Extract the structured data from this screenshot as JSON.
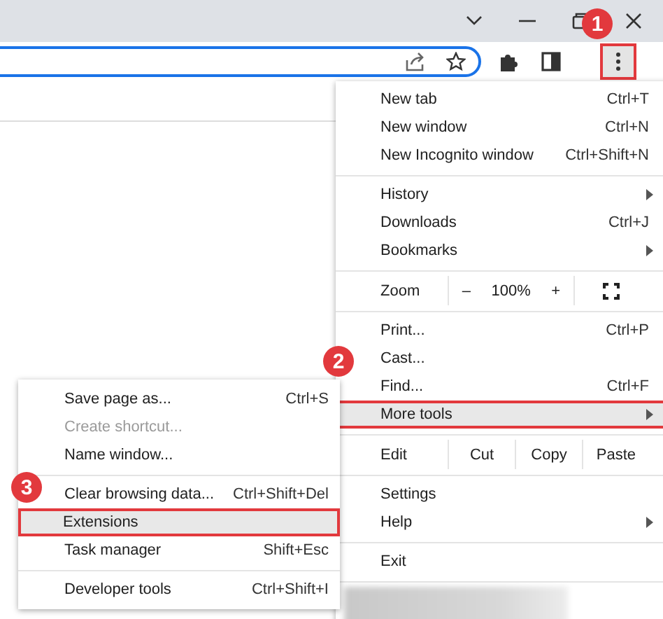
{
  "menu": {
    "sections": [
      [
        {
          "kind": "item",
          "label": "New tab",
          "shortcut": "Ctrl+T",
          "submenu": false,
          "highlighted": false,
          "disabled": false
        },
        {
          "kind": "item",
          "label": "New window",
          "shortcut": "Ctrl+N",
          "submenu": false,
          "highlighted": false,
          "disabled": false
        },
        {
          "kind": "item",
          "label": "New Incognito window",
          "shortcut": "Ctrl+Shift+N",
          "submenu": false,
          "highlighted": false,
          "disabled": false
        }
      ],
      [
        {
          "kind": "item",
          "label": "History",
          "submenu": true,
          "highlighted": false,
          "disabled": false
        },
        {
          "kind": "item",
          "label": "Downloads",
          "shortcut": "Ctrl+J",
          "submenu": false,
          "highlighted": false,
          "disabled": false
        },
        {
          "kind": "item",
          "label": "Bookmarks",
          "submenu": true,
          "highlighted": false,
          "disabled": false
        }
      ],
      [
        {
          "kind": "zoom",
          "label": "Zoom",
          "minus": "–",
          "value": "100%",
          "plus": "+"
        }
      ],
      [
        {
          "kind": "item",
          "label": "Print...",
          "shortcut": "Ctrl+P",
          "submenu": false,
          "highlighted": false,
          "disabled": false
        },
        {
          "kind": "item",
          "label": "Cast...",
          "submenu": false,
          "highlighted": false,
          "disabled": false
        },
        {
          "kind": "item",
          "label": "Find...",
          "shortcut": "Ctrl+F",
          "submenu": false,
          "highlighted": false,
          "disabled": false
        },
        {
          "kind": "item",
          "label": "More tools",
          "submenu": true,
          "highlighted": true,
          "disabled": false
        }
      ],
      [
        {
          "kind": "edit",
          "label": "Edit",
          "buttons": [
            "Cut",
            "Copy",
            "Paste"
          ]
        }
      ],
      [
        {
          "kind": "item",
          "label": "Settings",
          "submenu": false,
          "highlighted": false,
          "disabled": false
        },
        {
          "kind": "item",
          "label": "Help",
          "submenu": true,
          "highlighted": false,
          "disabled": false
        }
      ],
      [
        {
          "kind": "item",
          "label": "Exit",
          "submenu": false,
          "highlighted": false,
          "disabled": false
        }
      ],
      [
        {
          "kind": "redacted"
        }
      ]
    ]
  },
  "submenu": {
    "sections": [
      [
        {
          "kind": "item",
          "label": "Save page as...",
          "shortcut": "Ctrl+S",
          "submenu": false,
          "highlighted": false,
          "disabled": false
        },
        {
          "kind": "item",
          "label": "Create shortcut...",
          "submenu": false,
          "highlighted": false,
          "disabled": true
        },
        {
          "kind": "item",
          "label": "Name window...",
          "submenu": false,
          "highlighted": false,
          "disabled": false
        }
      ],
      [
        {
          "kind": "item",
          "label": "Clear browsing data...",
          "shortcut": "Ctrl+Shift+Del",
          "submenu": false,
          "highlighted": false,
          "disabled": false
        },
        {
          "kind": "item",
          "label": "Extensions",
          "submenu": false,
          "highlighted": true,
          "disabled": false
        },
        {
          "kind": "item",
          "label": "Task manager",
          "shortcut": "Shift+Esc",
          "submenu": false,
          "highlighted": false,
          "disabled": false
        }
      ],
      [
        {
          "kind": "item",
          "label": "Developer tools",
          "shortcut": "Ctrl+Shift+I",
          "submenu": false,
          "highlighted": false,
          "disabled": false
        }
      ]
    ]
  },
  "step_badges": [
    {
      "number": "1"
    },
    {
      "number": "2"
    },
    {
      "number": "3"
    }
  ]
}
